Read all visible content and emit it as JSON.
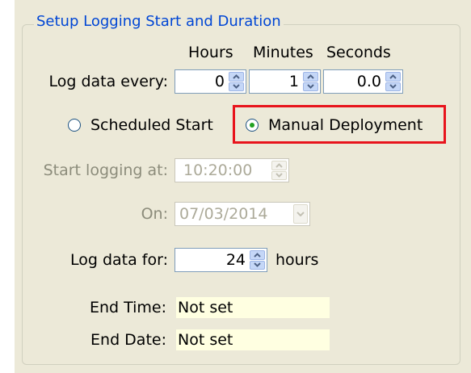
{
  "group": {
    "title": "Setup Logging Start and Duration"
  },
  "interval": {
    "label": "Log data every:",
    "headers": {
      "hours": "Hours",
      "minutes": "Minutes",
      "seconds": "Seconds"
    },
    "hours_value": "0",
    "minutes_value": "1",
    "seconds_value": "0.0"
  },
  "start_mode": {
    "scheduled_label": "Scheduled Start",
    "manual_label": "Manual Deployment",
    "selected": "manual"
  },
  "start_time": {
    "label": "Start logging at:",
    "value": "10:20:00",
    "enabled": false
  },
  "start_date": {
    "label": "On:",
    "value": "07/03/2014",
    "enabled": false
  },
  "duration": {
    "label": "Log data for:",
    "value": "24",
    "unit": "hours"
  },
  "end": {
    "time_label": "End Time:",
    "time_value": "Not set",
    "date_label": "End Date:",
    "date_value": "Not set"
  },
  "colors": {
    "panel_bg": "#ece9d8",
    "group_title": "#0046d5",
    "highlight": "#e8141c",
    "readonly_bg": "#ffffe1",
    "radio_selected": "#21a121"
  }
}
